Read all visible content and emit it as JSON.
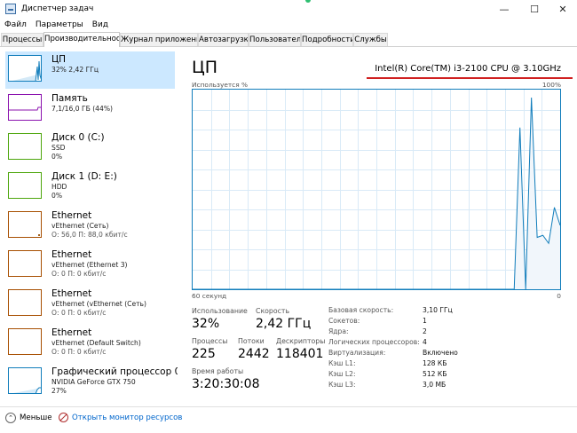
{
  "window": {
    "title": "Диспетчер задач",
    "min_glyph": "—",
    "max_glyph": "☐",
    "close_glyph": "✕"
  },
  "menu": [
    "Файл",
    "Параметры",
    "Вид"
  ],
  "tabs": [
    {
      "label": "Процессы",
      "active": false
    },
    {
      "label": "Производительность",
      "active": true
    },
    {
      "label": "Журнал приложений",
      "active": false
    },
    {
      "label": "Автозагрузка",
      "active": false
    },
    {
      "label": "Пользователи",
      "active": false
    },
    {
      "label": "Подробности",
      "active": false
    },
    {
      "label": "Службы",
      "active": false
    }
  ],
  "sidebar": {
    "items": [
      {
        "name": "ЦП",
        "line1": "32% 2,42 ГГц",
        "line2": "",
        "color": "#117dbb"
      },
      {
        "name": "Память",
        "line1": "7,1/16,0 ГБ (44%)",
        "line2": "",
        "color": "#8b12ae"
      },
      {
        "name": "Диск 0 (C:)",
        "line1": "SSD",
        "line2": "0%",
        "color": "#4da60c"
      },
      {
        "name": "Диск 1 (D: E:)",
        "line1": "HDD",
        "line2": "0%",
        "color": "#4da60c"
      },
      {
        "name": "Ethernet",
        "line1": "vEthernet (Сеть)",
        "line2": "О: 56,0 П: 88,0 кбит/с",
        "color": "#a74f01"
      },
      {
        "name": "Ethernet",
        "line1": "vEthernet (Ethernet 3)",
        "line2": "О: 0 П: 0 кбит/с",
        "color": "#a74f01"
      },
      {
        "name": "Ethernet",
        "line1": "vEthernet (vEthernet (Сеть)",
        "line2": "О: 0 П: 0 кбит/с",
        "color": "#a74f01"
      },
      {
        "name": "Ethernet",
        "line1": "vEthernet (Default Switch)",
        "line2": "О: 0 П: 0 кбит/с",
        "color": "#a74f01"
      },
      {
        "name": "Графический процессор 0",
        "line1": "NVIDIA GeForce GTX 750",
        "line2": "27%",
        "color": "#117dbb"
      }
    ]
  },
  "main": {
    "title": "ЦП",
    "model": "Intel(R) Core(TM) i3-2100 CPU @ 3.10GHz",
    "graph_top_left": "Используется %",
    "graph_top_right": "100%",
    "graph_bottom_left": "60 секунд",
    "graph_bottom_right": "0",
    "graph_values": [
      0,
      0,
      0,
      0,
      0,
      0,
      0,
      0,
      0,
      0,
      0,
      0,
      0,
      0,
      0,
      0,
      0,
      0,
      0,
      0,
      0,
      0,
      0,
      0,
      0,
      0,
      0,
      0,
      0,
      0,
      0,
      0,
      0,
      0,
      0,
      0,
      0,
      0,
      0,
      0,
      0,
      0,
      0,
      0,
      0,
      0,
      0,
      0,
      0,
      0,
      0,
      0,
      0,
      0,
      0,
      0,
      0,
      81,
      0,
      96,
      26,
      27,
      23,
      41,
      32
    ],
    "stats": {
      "usage_label": "Использование",
      "usage_value": "32%",
      "speed_label": "Скорость",
      "speed_value": "2,42 ГГц",
      "processes_label": "Процессы",
      "processes_value": "225",
      "threads_label": "Потоки",
      "threads_value": "2442",
      "handles_label": "Дескрипторы",
      "handles_value": "118401",
      "uptime_label": "Время работы",
      "uptime_value": "3:20:30:08"
    },
    "details": [
      {
        "label": "Базовая скорость:",
        "value": "3,10 ГГц"
      },
      {
        "label": "Сокетов:",
        "value": "1"
      },
      {
        "label": "Ядра:",
        "value": "2"
      },
      {
        "label": "Логических процессоров:",
        "value": "4"
      },
      {
        "label": "Виртуализация:",
        "value": "Включено"
      },
      {
        "label": "Кэш L1:",
        "value": "128 КБ"
      },
      {
        "label": "Кэш L2:",
        "value": "512 КБ"
      },
      {
        "label": "Кэш L3:",
        "value": "3,0 МБ"
      }
    ]
  },
  "footer": {
    "fewer_label": "Меньше",
    "fewer_glyph": "⌃",
    "monitor_label": "Открыть монитор ресурсов"
  }
}
